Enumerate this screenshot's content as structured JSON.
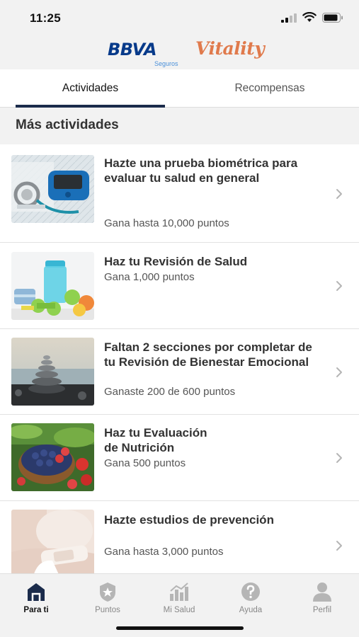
{
  "status_bar": {
    "time": "11:25"
  },
  "brand": {
    "bbva": "BBVA",
    "bbva_sub": "Seguros",
    "vitality": "Vitality",
    "bbva_color": "#073a8a",
    "vitality_color": "#e07a4c"
  },
  "tabs": [
    {
      "label": "Actividades",
      "active": true
    },
    {
      "label": "Recompensas",
      "active": false
    }
  ],
  "section": {
    "title": "Más actividades"
  },
  "activities": [
    {
      "title": "Hazte una prueba biométrica para evaluar tu salud en general",
      "subtitle": "Gana hasta 10,000 puntos",
      "image": "glucometer-stethoscope"
    },
    {
      "title": "Haz tu Revisión de Salud",
      "subtitle": "Gana 1,000 puntos",
      "image": "shaker-dumbbells"
    },
    {
      "title": "Faltan 2 secciones por completar de tu Revisión de Bienestar Emocional",
      "subtitle": "Ganaste 200 de 600 puntos",
      "image": "stacked-stones"
    },
    {
      "title": "Haz tu Evaluación\nde Nutrición",
      "subtitle": "Gana 500 puntos",
      "image": "fruit-bowl"
    },
    {
      "title": "Hazte estudios de prevención",
      "subtitle": "Gana hasta 3,000 puntos",
      "image": "bandage-arm"
    }
  ],
  "bottom_nav": [
    {
      "label": "Para ti",
      "icon": "home-icon",
      "active": true
    },
    {
      "label": "Puntos",
      "icon": "badge-star-icon",
      "active": false
    },
    {
      "label": "Mi Salud",
      "icon": "bar-chart-icon",
      "active": false
    },
    {
      "label": "Ayuda",
      "icon": "help-icon",
      "active": false
    },
    {
      "label": "Perfil",
      "icon": "person-icon",
      "active": false
    }
  ]
}
